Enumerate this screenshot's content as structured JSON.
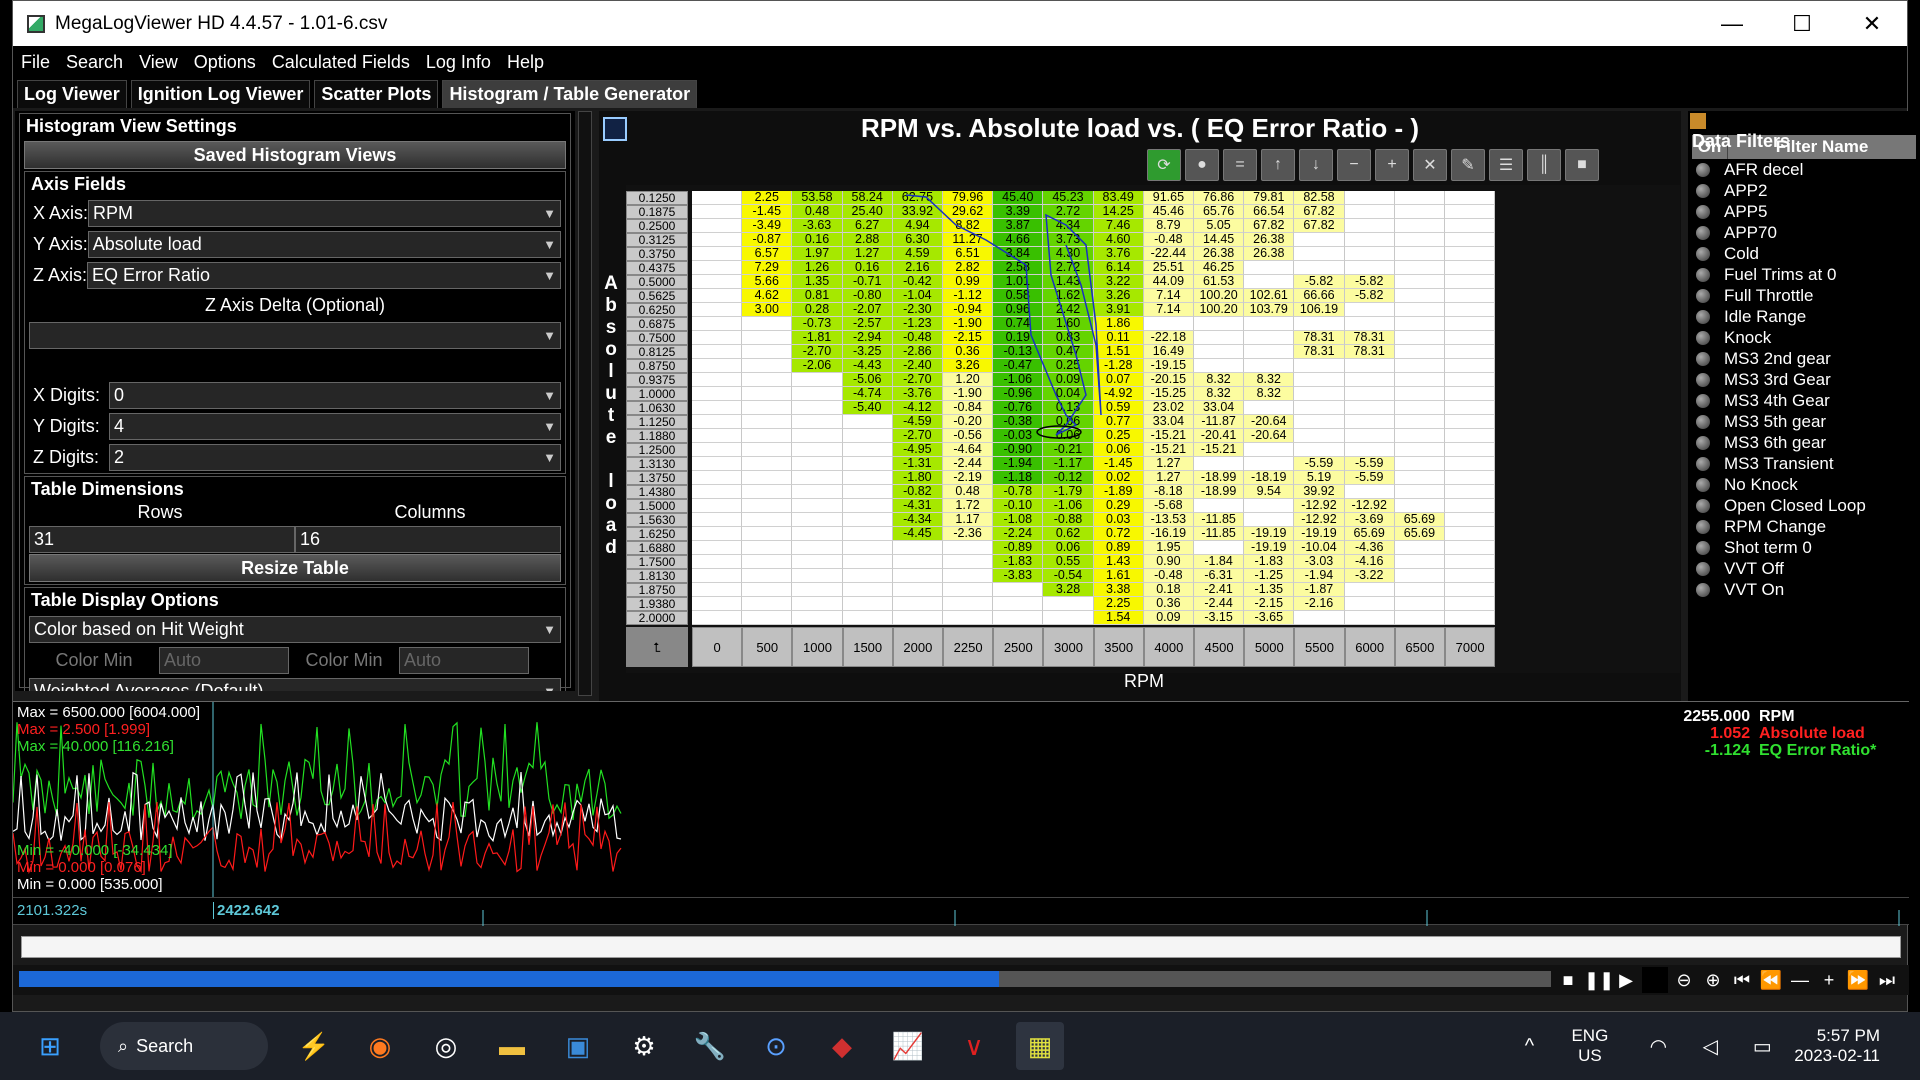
{
  "window": {
    "title": "MegaLogViewer HD 4.4.57 - 1.01-6.csv"
  },
  "menu": [
    "File",
    "Search",
    "View",
    "Options",
    "Calculated Fields",
    "Log Info",
    "Help"
  ],
  "tabs": [
    "Log Viewer",
    "Ignition Log Viewer",
    "Scatter Plots",
    "Histogram / Table Generator"
  ],
  "settings": {
    "header": "Histogram View Settings",
    "saved_button": "Saved Histogram Views",
    "axis_fields_title": "Axis Fields",
    "x_axis_label": "X Axis:",
    "x_axis_value": "RPM",
    "y_axis_label": "Y Axis:",
    "y_axis_value": "Absolute load",
    "z_axis_label": "Z Axis:",
    "z_axis_value": "EQ Error Ratio",
    "z_delta_label": "Z Axis Delta (Optional)",
    "z_delta_value": "",
    "x_digits_label": "X Digits:",
    "x_digits_value": "0",
    "y_digits_label": "Y Digits:",
    "y_digits_value": "4",
    "z_digits_label": "Z Digits:",
    "z_digits_value": "2",
    "table_dims_title": "Table Dimensions",
    "rows_label": "Rows",
    "rows_value": "31",
    "cols_label": "Columns",
    "cols_value": "16",
    "resize_button": "Resize Table",
    "display_title": "Table Display Options",
    "display_value": "Color based on Hit Weight",
    "color_min_label": "Color Min",
    "color_min_value": "Auto",
    "color_max_label": "Color Min",
    "color_max_value": "Auto",
    "weighted_label": "Weighted Averages (Default)"
  },
  "chart": {
    "title": "RPM vs. Absolute load vs. ( EQ Error Ratio -   )",
    "yaxis_label": "Absolute load",
    "xaxis_label": "RPM"
  },
  "table": {
    "x_values": [
      "0",
      "500",
      "1000",
      "1500",
      "2000",
      "2250",
      "2500",
      "3000",
      "3500",
      "4000",
      "4500",
      "5000",
      "5500",
      "6000",
      "6500",
      "7000"
    ],
    "y_values": [
      "0.1250",
      "0.1875",
      "0.2500",
      "0.3125",
      "0.3750",
      "0.4375",
      "0.5000",
      "0.5625",
      "0.6250",
      "0.6875",
      "0.7500",
      "0.8125",
      "0.8750",
      "0.9375",
      "1.0000",
      "1.0630",
      "1.1250",
      "1.1880",
      "1.2500",
      "1.3130",
      "1.3750",
      "1.4380",
      "1.5000",
      "1.5630",
      "1.6250",
      "1.6880",
      "1.7500",
      "1.8130",
      "1.8750",
      "1.9380",
      "2.0000"
    ],
    "rows": [
      [
        "",
        "2.25",
        "53.58",
        "58.24",
        "62.75",
        "79.96",
        "45.40",
        "45.23",
        "83.49",
        "91.65",
        "76.86",
        "79.81",
        "82.58",
        "",
        "",
        ""
      ],
      [
        "",
        "-1.45",
        "0.48",
        "25.40",
        "33.92",
        "29.62",
        "3.39",
        "2.72",
        "14.25",
        "45.46",
        "65.76",
        "66.54",
        "67.82",
        "",
        "",
        ""
      ],
      [
        "",
        "-3.49",
        "-3.63",
        "6.27",
        "4.94",
        "8.82",
        "3.87",
        "4.34",
        "7.46",
        "8.79",
        "5.05",
        "67.82",
        "67.82",
        "",
        "",
        ""
      ],
      [
        "",
        "-0.87",
        "0.16",
        "2.88",
        "6.30",
        "11.27",
        "4.66",
        "3.73",
        "4.60",
        "-0.48",
        "14.45",
        "26.38",
        "",
        "",
        "",
        ""
      ],
      [
        "",
        "6.57",
        "1.97",
        "1.27",
        "4.59",
        "6.51",
        "3.84",
        "4.30",
        "3.76",
        "-22.44",
        "26.38",
        "26.38",
        "",
        "",
        "",
        ""
      ],
      [
        "",
        "7.29",
        "1.26",
        "0.16",
        "2.16",
        "2.82",
        "2.58",
        "2.72",
        "6.14",
        "25.51",
        "46.25",
        "",
        "",
        "",
        "",
        ""
      ],
      [
        "",
        "5.66",
        "1.35",
        "-0.71",
        "-0.42",
        "0.99",
        "1.01",
        "1.43",
        "3.22",
        "44.09",
        "61.53",
        "",
        "-5.82",
        "-5.82",
        "",
        ""
      ],
      [
        "",
        "4.62",
        "0.81",
        "-0.80",
        "-1.04",
        "-1.12",
        "0.58",
        "1.62",
        "3.26",
        "7.14",
        "100.20",
        "102.61",
        "66.66",
        "-5.82",
        "",
        ""
      ],
      [
        "",
        "3.00",
        "0.28",
        "-2.07",
        "-2.30",
        "-0.94",
        "0.96",
        "2.42",
        "3.91",
        "7.14",
        "100.20",
        "103.79",
        "106.19",
        "",
        "",
        ""
      ],
      [
        "",
        "",
        "-0.73",
        "-2.57",
        "-1.23",
        "-1.90",
        "0.74",
        "1.60",
        "1.86",
        "",
        "",
        "",
        "",
        "",
        "",
        ""
      ],
      [
        "",
        "",
        "-1.81",
        "-2.94",
        "-0.48",
        "-2.15",
        "0.19",
        "0.83",
        "0.11",
        "-22.18",
        "",
        "",
        "78.31",
        "78.31",
        "",
        ""
      ],
      [
        "",
        "",
        "-2.70",
        "-3.25",
        "-2.86",
        "0.36",
        "-0.13",
        "0.47",
        "1.51",
        "16.49",
        "",
        "",
        "78.31",
        "78.31",
        "",
        ""
      ],
      [
        "",
        "",
        "-2.06",
        "-4.43",
        "-2.40",
        "3.26",
        "-0.47",
        "0.25",
        "-1.28",
        "-19.15",
        "",
        "",
        "",
        "",
        "",
        ""
      ],
      [
        "",
        "",
        "",
        "-5.06",
        "-2.70",
        "1.20",
        "-1.06",
        "0.09",
        "0.07",
        "-20.15",
        "8.32",
        "8.32",
        "",
        "",
        "",
        ""
      ],
      [
        "",
        "",
        "",
        "-4.74",
        "-3.76",
        "-1.90",
        "-0.96",
        "0.04",
        "-4.92",
        "-15.25",
        "8.32",
        "8.32",
        "",
        "",
        "",
        ""
      ],
      [
        "",
        "",
        "",
        "-5.40",
        "-4.12",
        "-0.84",
        "-0.76",
        "0.13",
        "0.59",
        "23.02",
        "33.04",
        "",
        "",
        "",
        "",
        ""
      ],
      [
        "",
        "",
        "",
        "",
        "-4.59",
        "-0.20",
        "-0.38",
        "0.06",
        "0.77",
        "33.04",
        "-11.87",
        "-20.64",
        "",
        "",
        "",
        ""
      ],
      [
        "",
        "",
        "",
        "",
        "-2.70",
        "-0.56",
        "-0.03",
        "0.06",
        "0.25",
        "-15.21",
        "-20.41",
        "-20.64",
        "",
        "",
        "",
        ""
      ],
      [
        "",
        "",
        "",
        "",
        "-4.95",
        "-4.64",
        "-0.90",
        "-0.21",
        "0.06",
        "-15.21",
        "-15.21",
        "",
        "",
        "",
        "",
        ""
      ],
      [
        "",
        "",
        "",
        "",
        "-1.31",
        "-2.44",
        "-1.94",
        "-1.17",
        "-1.45",
        "1.27",
        "",
        "",
        "-5.59",
        "-5.59",
        "",
        ""
      ],
      [
        "",
        "",
        "",
        "",
        "-1.80",
        "-2.19",
        "-1.18",
        "-0.12",
        "0.02",
        "1.27",
        "-18.99",
        "-18.19",
        "5.19",
        "-5.59",
        "",
        ""
      ],
      [
        "",
        "",
        "",
        "",
        "-0.82",
        "0.48",
        "-0.78",
        "-1.79",
        "-1.89",
        "-8.18",
        "-18.99",
        "9.54",
        "39.92",
        "",
        "",
        ""
      ],
      [
        "",
        "",
        "",
        "",
        "-4.31",
        "1.72",
        "-0.10",
        "-1.06",
        "0.29",
        "-5.68",
        "",
        "",
        "-12.92",
        "-12.92",
        "",
        ""
      ],
      [
        "",
        "",
        "",
        "",
        "-4.34",
        "1.17",
        "-1.08",
        "-0.88",
        "0.03",
        "-13.53",
        "-11.85",
        "",
        "-12.92",
        "-3.69",
        "65.69",
        ""
      ],
      [
        "",
        "",
        "",
        "",
        "-4.45",
        "-2.36",
        "-2.24",
        "0.62",
        "0.72",
        "-16.19",
        "-11.85",
        "-19.19",
        "-19.19",
        "65.69",
        "65.69",
        ""
      ],
      [
        "",
        "",
        "",
        "",
        "",
        "",
        "-0.89",
        "0.06",
        "0.89",
        "1.95",
        "",
        "-19.19",
        "-10.04",
        "-4.36",
        "",
        ""
      ],
      [
        "",
        "",
        "",
        "",
        "",
        "",
        "-1.83",
        "0.55",
        "1.43",
        "0.90",
        "-1.84",
        "-1.83",
        "-3.03",
        "-4.16",
        "",
        ""
      ],
      [
        "",
        "",
        "",
        "",
        "",
        "",
        "-3.83",
        "-0.54",
        "1.61",
        "-0.48",
        "-6.31",
        "-1.25",
        "-1.94",
        "-3.22",
        "",
        ""
      ],
      [
        "",
        "",
        "",
        "",
        "",
        "",
        "",
        "3.28",
        "3.38",
        "0.18",
        "-2.41",
        "-1.35",
        "-1.87",
        "",
        "",
        ""
      ],
      [
        "",
        "",
        "",
        "",
        "",
        "",
        "",
        "",
        "2.25",
        "0.36",
        "-2.44",
        "-2.15",
        "-2.16",
        "",
        "",
        ""
      ],
      [
        "",
        "",
        "",
        "",
        "",
        "",
        "",
        "",
        "1.54",
        "0.09",
        "-3.15",
        "-3.65",
        "",
        "",
        "",
        ""
      ]
    ]
  },
  "filters": {
    "title": "Data Filters",
    "col_on": "On",
    "col_name": "Filter Name",
    "items": [
      "AFR decel",
      "APP2",
      "APP5",
      "APP70",
      "Cold",
      "Fuel Trims at 0",
      "Full Throttle",
      "Idle Range",
      "Knock",
      "MS3 2nd gear",
      "MS3 3rd Gear",
      "MS3 4th Gear",
      "MS3 5th gear",
      "MS3 6th gear",
      "MS3 Transient",
      "No Knock",
      "Open Closed Loop",
      "RPM Change",
      "Shot term 0",
      "VVT Off",
      "VVT On"
    ]
  },
  "graph": {
    "max_rpm": "Max = 6500.000 [6004.000]",
    "max_load": "Max = 2.500 [1.999]",
    "max_eq": "Max = 40.000 [116.216]",
    "min_eq": "Min = -40.000 [-34.434]",
    "min_load": "Min = 0.000 [0.076]",
    "min_rpm": "Min = 0.000 [535.000]",
    "cursor_rpm_value": "2255.000",
    "cursor_rpm_name": "RPM",
    "cursor_load_value": "1.052",
    "cursor_load_name": "Absolute load",
    "cursor_eq_value": "-1.124",
    "cursor_eq_name": "EQ Error Ratio*",
    "time_left": "2101.322s",
    "time_cursor": "2422.642",
    "progress": 0.64
  },
  "taskbar": {
    "search": "Search",
    "lang1": "ENG",
    "lang2": "US",
    "time": "5:57 PM",
    "date": "2023-02-11"
  },
  "colors": {
    "green_dark": "#39c000",
    "green_mid": "#64d400",
    "green_light": "#a6e800",
    "yellow": "#f8f800",
    "pale": "#fcfca0",
    "blank": "#ffffff"
  }
}
